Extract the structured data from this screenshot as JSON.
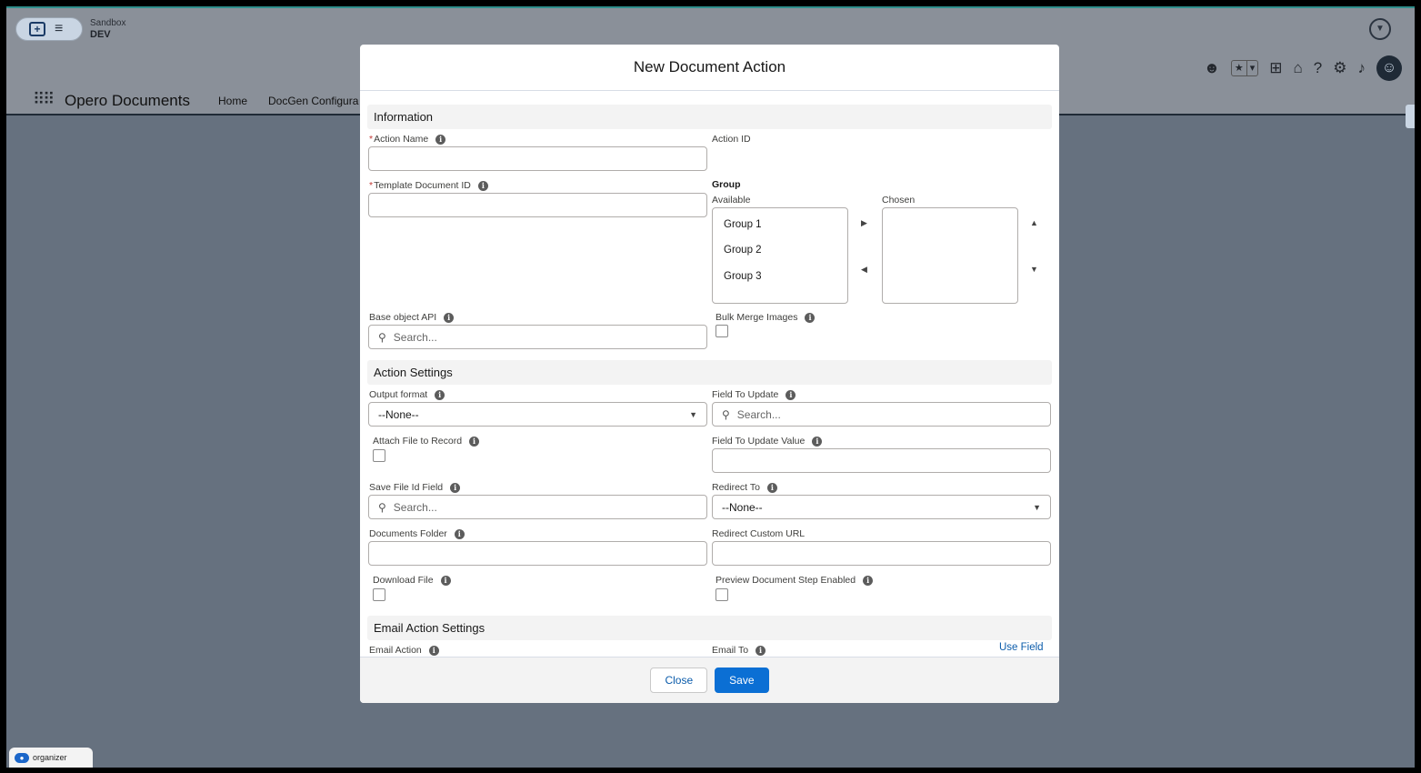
{
  "sandbox": {
    "label": "Sandbox",
    "env": "DEV"
  },
  "app": {
    "name": "Opero Documents",
    "nav": [
      "Home",
      "DocGen Configura"
    ]
  },
  "organizer": {
    "label": "organizer"
  },
  "modal": {
    "title": "New Document Action",
    "sections": {
      "information": "Information",
      "action_settings": "Action Settings",
      "email_action_settings": "Email Action Settings"
    },
    "fields": {
      "action_name": {
        "label": "Action Name",
        "value": ""
      },
      "action_id": {
        "label": "Action ID"
      },
      "template_document_id": {
        "label": "Template Document ID",
        "value": ""
      },
      "group": {
        "label": "Group",
        "available_label": "Available",
        "chosen_label": "Chosen",
        "options": [
          "Group 1",
          "Group 2",
          "Group 3"
        ]
      },
      "base_object_api": {
        "label": "Base object API",
        "placeholder": "Search..."
      },
      "bulk_merge_images": {
        "label": "Bulk Merge Images"
      },
      "output_format": {
        "label": "Output format",
        "value": "--None--"
      },
      "field_to_update": {
        "label": "Field To Update",
        "placeholder": "Search..."
      },
      "attach_file_to_record": {
        "label": "Attach File to Record"
      },
      "field_to_update_value": {
        "label": "Field To Update Value",
        "value": ""
      },
      "save_file_id_field": {
        "label": "Save File Id Field",
        "placeholder": "Search..."
      },
      "redirect_to": {
        "label": "Redirect To",
        "value": "--None--"
      },
      "documents_folder": {
        "label": "Documents Folder",
        "value": ""
      },
      "redirect_custom_url": {
        "label": "Redirect Custom URL",
        "value": ""
      },
      "download_file": {
        "label": "Download File"
      },
      "preview_document_step_enabled": {
        "label": "Preview Document Step Enabled"
      },
      "email_action": {
        "label": "Email Action"
      },
      "email_to": {
        "label": "Email To",
        "link": "Use Field"
      }
    },
    "footer": {
      "close": "Close",
      "save": "Save"
    }
  },
  "colors": {
    "brand": "#0b6fd4",
    "overlay": "#66717f",
    "required": "#c23934"
  }
}
